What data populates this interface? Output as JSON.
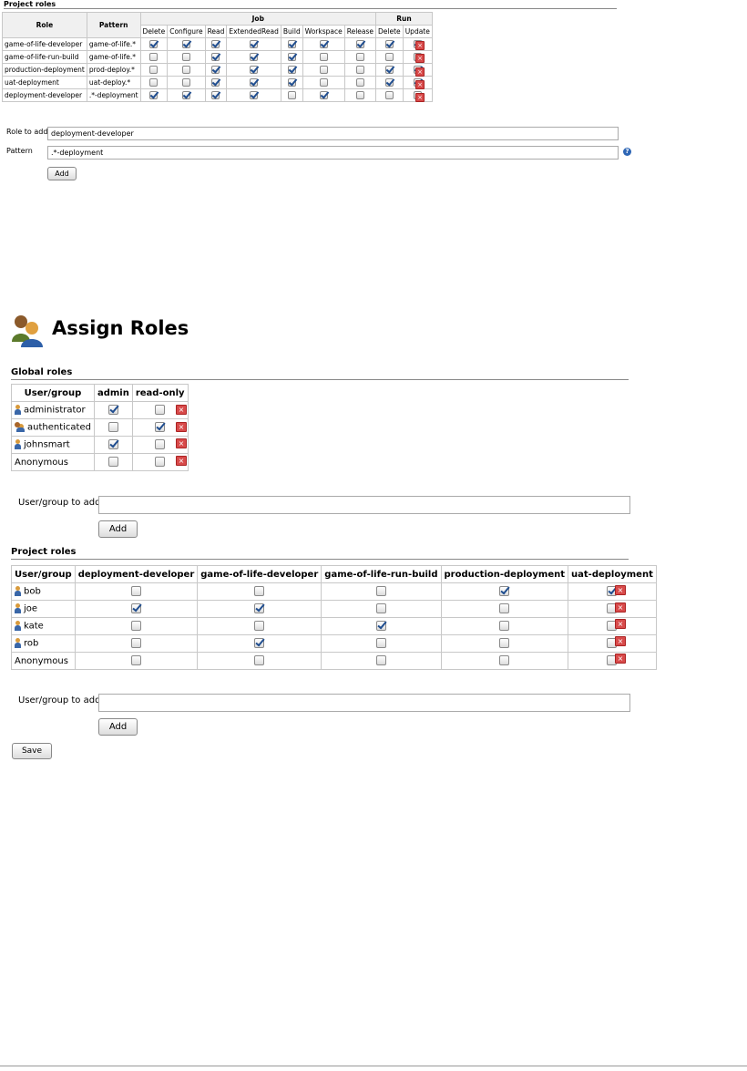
{
  "project_roles_section": {
    "title": "Project roles",
    "headers": {
      "role": "Role",
      "pattern": "Pattern",
      "job": "Job",
      "run": "Run",
      "job_perms": [
        "Delete",
        "Configure",
        "Read",
        "ExtendedRead",
        "Build",
        "Workspace",
        "Release"
      ],
      "run_perms": [
        "Delete",
        "Update"
      ]
    },
    "rows": [
      {
        "role": "game-of-life-developer",
        "pattern": "game-of-life.*",
        "checks": [
          true,
          true,
          true,
          true,
          true,
          true,
          true,
          true,
          true
        ]
      },
      {
        "role": "game-of-life-run-build",
        "pattern": "game-of-life.*",
        "checks": [
          false,
          false,
          true,
          true,
          true,
          false,
          false,
          false,
          false
        ]
      },
      {
        "role": "production-deployment",
        "pattern": "prod-deploy.*",
        "checks": [
          false,
          false,
          true,
          true,
          true,
          false,
          false,
          true,
          true
        ]
      },
      {
        "role": "uat-deployment",
        "pattern": "uat-deploy.*",
        "checks": [
          false,
          false,
          true,
          true,
          true,
          false,
          false,
          true,
          true
        ]
      },
      {
        "role": "deployment-developer",
        "pattern": ".*-deployment",
        "checks": [
          true,
          true,
          true,
          true,
          false,
          true,
          false,
          false,
          false
        ]
      }
    ],
    "role_to_add_label": "Role to add",
    "role_to_add_value": "deployment-developer",
    "pattern_label": "Pattern",
    "pattern_value": ".*-deployment",
    "add_button": "Add"
  },
  "assign_roles": {
    "heading": "Assign Roles",
    "global_roles": {
      "title": "Global roles",
      "headers": [
        "User/group",
        "admin",
        "read-only"
      ],
      "rows": [
        {
          "name": "administrator",
          "icon": "user-icon",
          "checks": [
            true,
            false
          ]
        },
        {
          "name": "authenticated",
          "icon": "group-icon",
          "checks": [
            false,
            true
          ]
        },
        {
          "name": "johnsmart",
          "icon": "user-icon",
          "checks": [
            true,
            false
          ]
        },
        {
          "name": "Anonymous",
          "icon": "",
          "checks": [
            false,
            false
          ]
        }
      ],
      "user_to_add_label": "User/group to add",
      "add_button": "Add"
    },
    "project_roles": {
      "title": "Project roles",
      "headers": [
        "User/group",
        "deployment-developer",
        "game-of-life-developer",
        "game-of-life-run-build",
        "production-deployment",
        "uat-deployment"
      ],
      "rows": [
        {
          "name": "bob",
          "icon": "user-icon",
          "checks": [
            false,
            false,
            false,
            true,
            true
          ]
        },
        {
          "name": "joe",
          "icon": "user-icon",
          "checks": [
            true,
            true,
            false,
            false,
            false
          ]
        },
        {
          "name": "kate",
          "icon": "user-icon",
          "checks": [
            false,
            false,
            true,
            false,
            false
          ]
        },
        {
          "name": "rob",
          "icon": "user-icon",
          "checks": [
            false,
            true,
            false,
            false,
            false
          ]
        },
        {
          "name": "Anonymous",
          "icon": "",
          "checks": [
            false,
            false,
            false,
            false,
            false
          ]
        }
      ],
      "user_to_add_label": "User/group to add",
      "add_button": "Add"
    },
    "save_button": "Save"
  }
}
